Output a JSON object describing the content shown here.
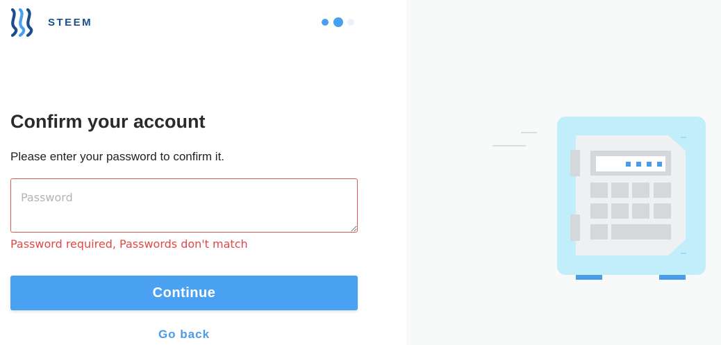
{
  "brand": {
    "name": "STEEM",
    "colors": {
      "brand_dark": "#1a4d8c",
      "accent": "#4ba1f1",
      "error": "#e04848",
      "right_panel_bg": "#f8f9f9",
      "safe_body": "#c2eefc"
    }
  },
  "progress": {
    "total_steps": 3,
    "current_step": 2
  },
  "form": {
    "title": "Confirm your account",
    "subtitle": "Please enter your password to confirm it.",
    "password_placeholder": "Password",
    "password_value": "",
    "error_message": "Password required, Passwords don't match",
    "continue_label": "Continue",
    "go_back_label": "Go back"
  },
  "illustration": {
    "icon": "safe-icon"
  }
}
